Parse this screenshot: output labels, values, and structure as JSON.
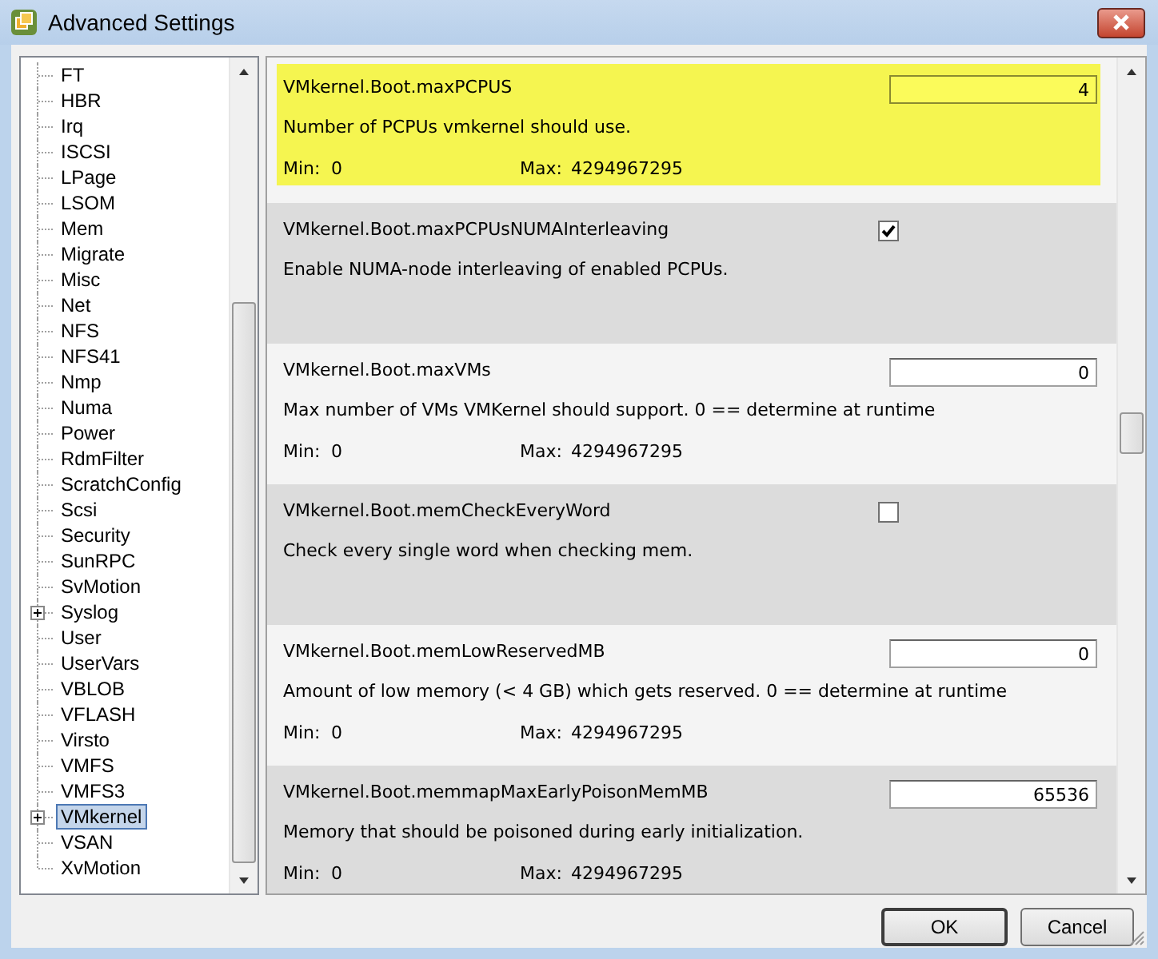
{
  "window": {
    "title": "Advanced Settings"
  },
  "tree": {
    "items": [
      {
        "label": "FT",
        "expandable": false,
        "selected": false
      },
      {
        "label": "HBR",
        "expandable": false,
        "selected": false
      },
      {
        "label": "Irq",
        "expandable": false,
        "selected": false
      },
      {
        "label": "ISCSI",
        "expandable": false,
        "selected": false
      },
      {
        "label": "LPage",
        "expandable": false,
        "selected": false
      },
      {
        "label": "LSOM",
        "expandable": false,
        "selected": false
      },
      {
        "label": "Mem",
        "expandable": false,
        "selected": false
      },
      {
        "label": "Migrate",
        "expandable": false,
        "selected": false
      },
      {
        "label": "Misc",
        "expandable": false,
        "selected": false
      },
      {
        "label": "Net",
        "expandable": false,
        "selected": false
      },
      {
        "label": "NFS",
        "expandable": false,
        "selected": false
      },
      {
        "label": "NFS41",
        "expandable": false,
        "selected": false
      },
      {
        "label": "Nmp",
        "expandable": false,
        "selected": false
      },
      {
        "label": "Numa",
        "expandable": false,
        "selected": false
      },
      {
        "label": "Power",
        "expandable": false,
        "selected": false
      },
      {
        "label": "RdmFilter",
        "expandable": false,
        "selected": false
      },
      {
        "label": "ScratchConfig",
        "expandable": false,
        "selected": false
      },
      {
        "label": "Scsi",
        "expandable": false,
        "selected": false
      },
      {
        "label": "Security",
        "expandable": false,
        "selected": false
      },
      {
        "label": "SunRPC",
        "expandable": false,
        "selected": false
      },
      {
        "label": "SvMotion",
        "expandable": false,
        "selected": false
      },
      {
        "label": "Syslog",
        "expandable": true,
        "selected": false
      },
      {
        "label": "User",
        "expandable": false,
        "selected": false
      },
      {
        "label": "UserVars",
        "expandable": false,
        "selected": false
      },
      {
        "label": "VBLOB",
        "expandable": false,
        "selected": false
      },
      {
        "label": "VFLASH",
        "expandable": false,
        "selected": false
      },
      {
        "label": "Virsto",
        "expandable": false,
        "selected": false
      },
      {
        "label": "VMFS",
        "expandable": false,
        "selected": false
      },
      {
        "label": "VMFS3",
        "expandable": false,
        "selected": false
      },
      {
        "label": "VMkernel",
        "expandable": true,
        "selected": true
      },
      {
        "label": "VSAN",
        "expandable": false,
        "selected": false
      },
      {
        "label": "XvMotion",
        "expandable": false,
        "selected": false
      }
    ]
  },
  "settings": [
    {
      "kind": "number",
      "name": "VMkernel.Boot.maxPCPUS",
      "value": "4",
      "description": "Number of PCPUs vmkernel should use.",
      "min_label": "Min:",
      "min": "0",
      "max_label": "Max:",
      "max": "4294967295",
      "selected": true
    },
    {
      "kind": "checkbox",
      "name": "VMkernel.Boot.maxPCPUsNUMAInterleaving",
      "checked": true,
      "description": "Enable NUMA-node interleaving of enabled PCPUs.",
      "selected": false
    },
    {
      "kind": "number",
      "name": "VMkernel.Boot.maxVMs",
      "value": "0",
      "description": "Max number of VMs VMKernel should support. 0 == determine at runtime",
      "min_label": "Min:",
      "min": "0",
      "max_label": "Max:",
      "max": "4294967295",
      "selected": false
    },
    {
      "kind": "checkbox",
      "name": "VMkernel.Boot.memCheckEveryWord",
      "checked": false,
      "description": "Check every single word when checking mem.",
      "selected": false
    },
    {
      "kind": "number",
      "name": "VMkernel.Boot.memLowReservedMB",
      "value": "0",
      "description": "Amount of low memory (< 4 GB) which gets reserved. 0 == determine at runtime",
      "min_label": "Min:",
      "min": "0",
      "max_label": "Max:",
      "max": "4294967295",
      "selected": false
    },
    {
      "kind": "number",
      "name": "VMkernel.Boot.memmapMaxEarlyPoisonMemMB",
      "value": "65536",
      "description": "Memory that should be poisoned during early initialization.",
      "min_label": "Min:",
      "min": "0",
      "max_label": "Max:",
      "max": "4294967295",
      "selected": false
    }
  ],
  "buttons": [
    "OK",
    "Cancel"
  ]
}
